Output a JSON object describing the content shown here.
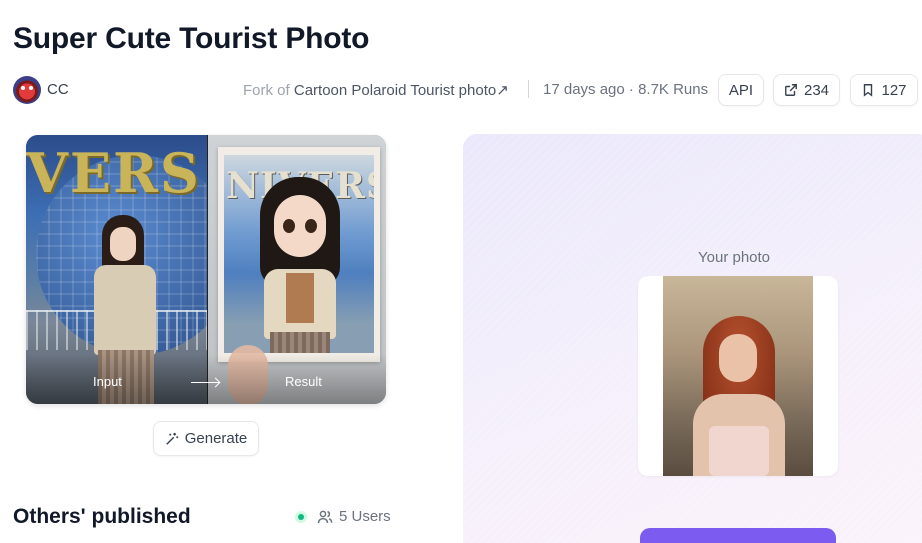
{
  "page": {
    "title": "Super Cute Tourist Photo"
  },
  "meta": {
    "author": "CC",
    "fork_prefix": "Fork of",
    "fork_name": "Cartoon Polaroid Tourist photo",
    "fork_arrow": "↗",
    "age": "17 days ago",
    "dot": "·",
    "runs": "8.7K Runs"
  },
  "actions": {
    "api_label": "API",
    "share_count": "234",
    "bookmark_count": "127"
  },
  "showcase": {
    "input_label": "Input",
    "result_label": "Result",
    "input_scene_text": "VERS",
    "result_scene_text": "NIVERS"
  },
  "generate": {
    "label": "Generate"
  },
  "others": {
    "heading": "Others' published",
    "users_count": "5 Users"
  },
  "upload": {
    "label": "Your photo"
  },
  "colors": {
    "accent": "#7c5cf0",
    "online": "#10b981"
  },
  "icons": [
    "avatar",
    "external-link-icon",
    "share-icon",
    "bookmark-icon",
    "magic-wand-icon",
    "users-icon",
    "online-dot-icon",
    "arrow-right-icon"
  ]
}
